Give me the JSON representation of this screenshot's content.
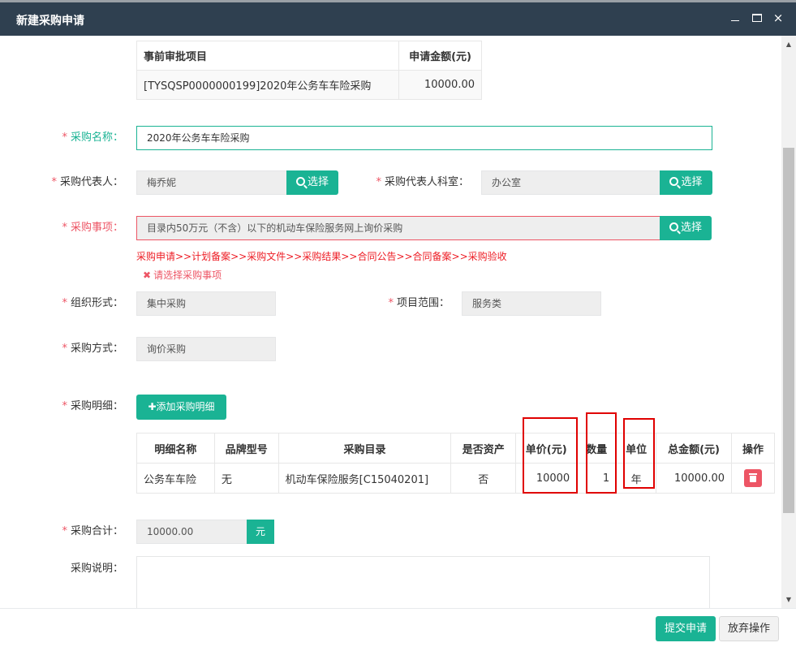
{
  "window": {
    "title": "新建采购申请",
    "minimize_icon": "minimize-icon",
    "maximize_icon": "maximize-icon",
    "close_glyph": "×"
  },
  "pre_approval": {
    "headers": {
      "project": "事前审批项目",
      "amount": "申请金额(元)"
    },
    "row": {
      "project": "[TYSQSP0000000199]2020年公务车车险采购",
      "amount": "10000.00"
    }
  },
  "form": {
    "name": {
      "label": "采购名称：",
      "value": "2020年公务车车险采购"
    },
    "rep": {
      "label": "采购代表人：",
      "value": "梅乔妮",
      "button": "选择"
    },
    "rep_dept": {
      "label": "采购代表人科室：",
      "value": "办公室",
      "button": "选择"
    },
    "matter": {
      "label": "采购事项：",
      "value": "目录内50万元（不含）以下的机动车保险服务网上询价采购",
      "button": "选择"
    },
    "flow": "采购申请>>计划备案>>采购文件>>采购结果>>合同公告>>合同备案>>采购验收",
    "error": "请选择采购事项",
    "error_icon": "✖",
    "org": {
      "label": "组织形式：",
      "value": "集中采购"
    },
    "scope": {
      "label": "项目范围：",
      "value": "服务类"
    },
    "method": {
      "label": "采购方式：",
      "value": "询价采购"
    },
    "details": {
      "label": "采购明细：",
      "add_button": "添加采购明细",
      "add_icon": "✚"
    },
    "total": {
      "label": "采购合计：",
      "value": "10000.00",
      "unit": "元"
    },
    "remark": {
      "label": "采购说明：",
      "value": ""
    },
    "required_mark": "*"
  },
  "detail_table": {
    "headers": [
      "明细名称",
      "品牌型号",
      "采购目录",
      "是否资产",
      "单价(元)",
      "数量",
      "单位",
      "总金额(元)",
      "操作"
    ],
    "rows": [
      {
        "name": "公务车车险",
        "brand": "无",
        "catalog": "机动车保险服务[C15040201]",
        "is_asset": "否",
        "unit_price": "10000",
        "qty": "1",
        "unit": "年",
        "total": "10000.00",
        "action_icon": "trash-icon"
      }
    ]
  },
  "footer": {
    "submit": "提交申请",
    "cancel": "放弃操作"
  },
  "colors": {
    "primary": "#1ab394",
    "danger": "#ed5565",
    "titlebar": "#2f4050",
    "highlight": "#e00000"
  }
}
